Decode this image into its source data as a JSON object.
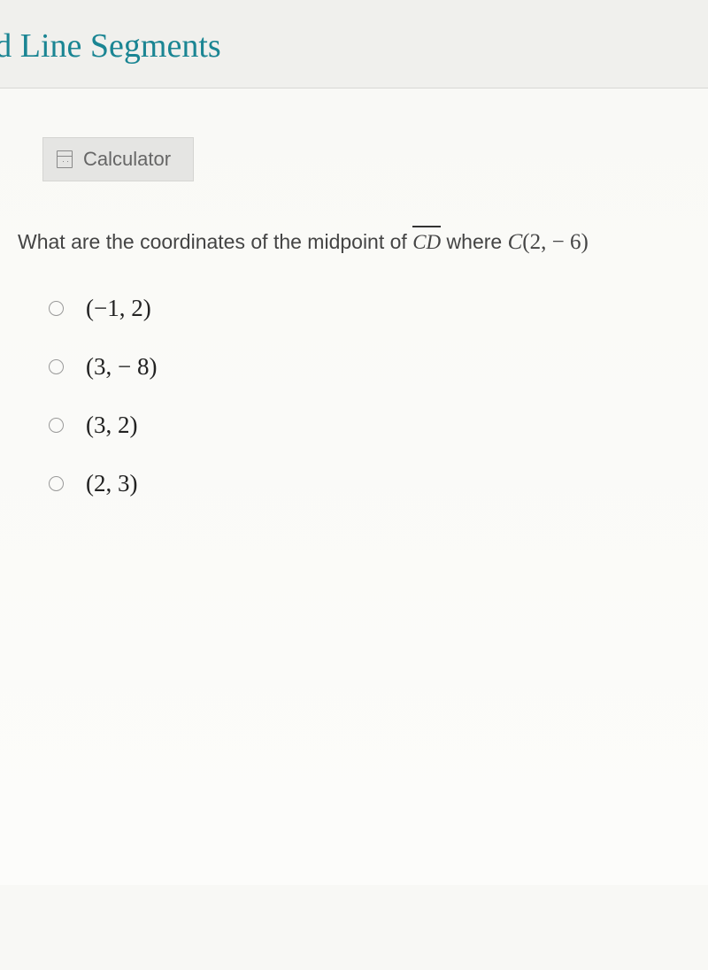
{
  "header": {
    "title": "cted Line Segments"
  },
  "toolbar": {
    "calculator_label": "Calculator"
  },
  "question": {
    "prefix": "What are the coordinates of the midpoint of ",
    "segment": "CD",
    "middle": " where  ",
    "point_label": "C",
    "point_coords": "(2,  − 6)"
  },
  "options": [
    {
      "text": "(−1, 2)"
    },
    {
      "text": "(3,  − 8)"
    },
    {
      "text": "(3, 2)"
    },
    {
      "text": "(2, 3)"
    }
  ]
}
